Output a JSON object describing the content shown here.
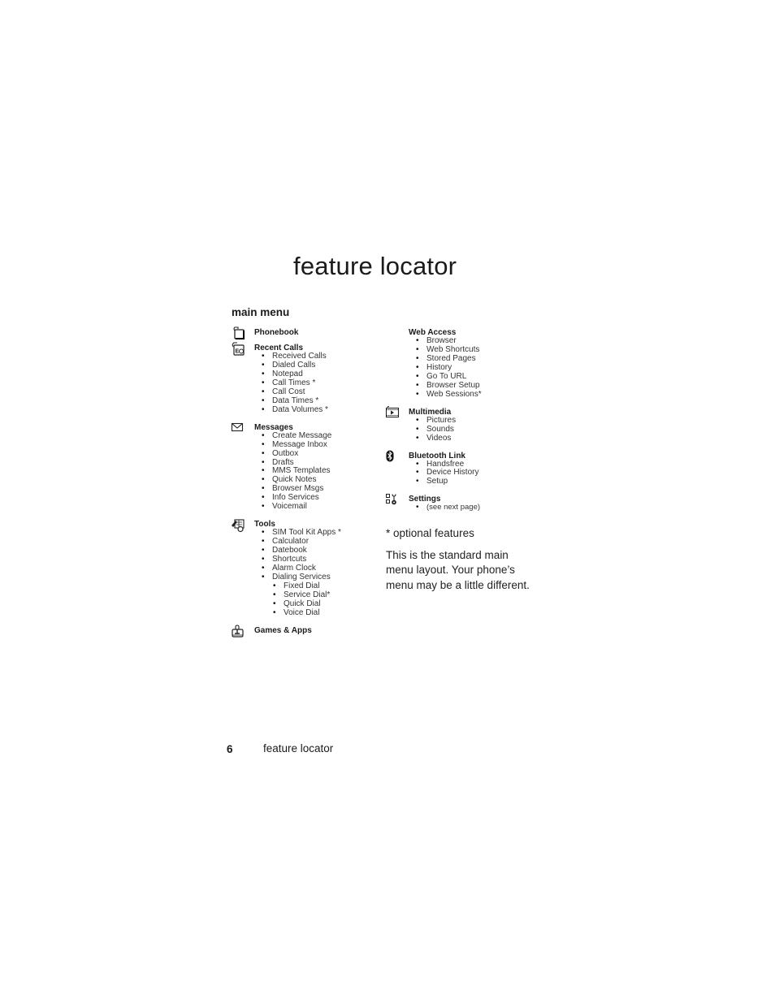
{
  "page": {
    "title": "feature locator",
    "section_title": "main menu",
    "footer": {
      "page_number": "6",
      "section_label": "feature locator"
    }
  },
  "menu": {
    "left_column": [
      {
        "label": "Phonebook",
        "icon": "phonebook-icon",
        "items": []
      },
      {
        "label": "Recent Calls",
        "icon": "recent-calls-icon",
        "items": [
          {
            "label": "Received Calls"
          },
          {
            "label": "Dialed Calls"
          },
          {
            "label": "Notepad"
          },
          {
            "label": "Call Times *"
          },
          {
            "label": "Call Cost"
          },
          {
            "label": "Data Times *"
          },
          {
            "label": "Data Volumes *"
          }
        ]
      },
      {
        "label": "Messages",
        "icon": "envelope-icon",
        "items": [
          {
            "label": "Create Message"
          },
          {
            "label": "Message Inbox"
          },
          {
            "label": "Outbox"
          },
          {
            "label": "Drafts"
          },
          {
            "label": "MMS Templates"
          },
          {
            "label": "Quick Notes"
          },
          {
            "label": "Browser Msgs"
          },
          {
            "label": "Info Services"
          },
          {
            "label": "Voicemail"
          }
        ]
      },
      {
        "label": "Tools",
        "icon": "tools-icon",
        "items": [
          {
            "label": "SIM Tool Kit Apps *"
          },
          {
            "label": "Calculator"
          },
          {
            "label": "Datebook"
          },
          {
            "label": "Shortcuts"
          },
          {
            "label": "Alarm Clock"
          },
          {
            "label": "Dialing Services",
            "sub": [
              {
                "label": "Fixed Dial"
              },
              {
                "label": "Service Dial*"
              },
              {
                "label": "Quick Dial"
              },
              {
                "label": "Voice Dial"
              }
            ]
          }
        ]
      },
      {
        "label": "Games & Apps",
        "icon": "games-joystick-icon",
        "items": []
      }
    ],
    "right_column": [
      {
        "label": "Web Access",
        "icon": "",
        "items": [
          {
            "label": "Browser"
          },
          {
            "label": "Web Shortcuts"
          },
          {
            "label": "Stored Pages"
          },
          {
            "label": "History"
          },
          {
            "label": "Go To URL"
          },
          {
            "label": "Browser Setup"
          },
          {
            "label": "Web Sessions*"
          }
        ]
      },
      {
        "label": "Multimedia",
        "icon": "multimedia-film-icon",
        "items": [
          {
            "label": "Pictures"
          },
          {
            "label": "Sounds"
          },
          {
            "label": "Videos"
          }
        ]
      },
      {
        "label": "Bluetooth Link",
        "icon": "bluetooth-icon",
        "items": [
          {
            "label": "Handsfree"
          },
          {
            "label": "Device History"
          },
          {
            "label": "Setup"
          }
        ]
      },
      {
        "label": "Settings",
        "icon": "settings-icon",
        "items": [
          {
            "label": "(see next page)"
          }
        ]
      }
    ]
  },
  "notes": {
    "optional": "* optional features",
    "description": "This is the standard main menu layout. Your phone’s menu may be a little different."
  }
}
